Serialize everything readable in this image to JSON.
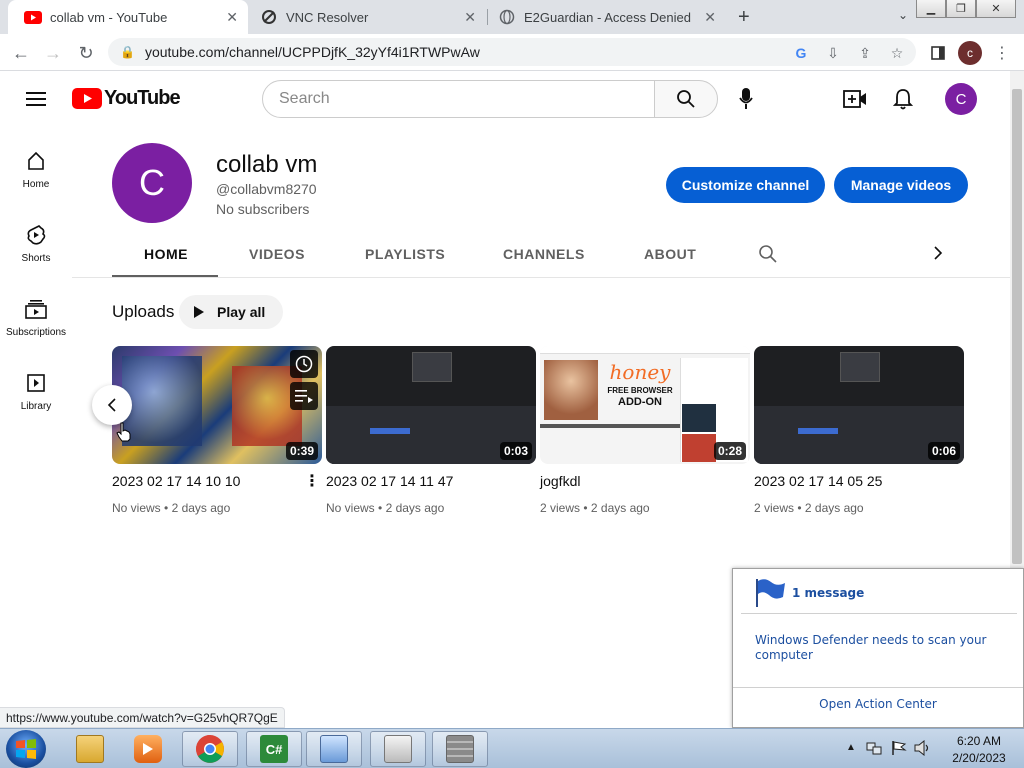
{
  "browser": {
    "tabs": [
      {
        "title": "collab vm - YouTube",
        "active": true
      },
      {
        "title": "VNC Resolver",
        "active": false
      },
      {
        "title": "E2Guardian - Access Denied",
        "active": false
      }
    ],
    "new_tab_symbol": "+",
    "url": "youtube.com/channel/UCPPDjfK_32yYf4i1RTWPwAw",
    "profile_initial": "c"
  },
  "youtube": {
    "logo_text": "YouTube",
    "search_placeholder": "Search",
    "account_initial": "C",
    "guide": [
      {
        "label": "Home",
        "icon": "home-icon"
      },
      {
        "label": "Shorts",
        "icon": "shorts-icon"
      },
      {
        "label": "Subscriptions",
        "icon": "subscriptions-icon"
      },
      {
        "label": "Library",
        "icon": "library-icon"
      }
    ],
    "channel": {
      "avatar_initial": "C",
      "name": "collab vm",
      "handle": "@collabvm8270",
      "subscribers": "No subscribers",
      "customize_label": "Customize channel",
      "manage_label": "Manage videos"
    },
    "tabs": [
      "HOME",
      "VIDEOS",
      "PLAYLISTS",
      "CHANNELS",
      "ABOUT"
    ],
    "active_tab": "HOME",
    "uploads_label": "Uploads",
    "play_all_label": "Play all",
    "videos": [
      {
        "title": "2023 02 17 14 10 10",
        "duration": "0:39",
        "views": "No views",
        "age": "2 days ago"
      },
      {
        "title": "2023 02 17 14 11 47",
        "duration": "0:03",
        "views": "No views",
        "age": "2 days ago"
      },
      {
        "title": "jogfkdl",
        "duration": "0:28",
        "views": "2 views",
        "age": "2 days ago"
      },
      {
        "title": "2023 02 17 14 05 25",
        "duration": "0:06",
        "views": "2 views",
        "age": "2 days ago"
      }
    ],
    "meta_separator": " • ",
    "thumb3": {
      "honey": "honey",
      "addon1": "FREE BROWSER",
      "addon2": "ADD-ON"
    }
  },
  "status_url": "https://www.youtube.com/watch?v=G25vhQR7QgE",
  "notification": {
    "count_text": "1 message",
    "message": "Windows Defender needs to scan your computer",
    "action": "Open Action Center"
  },
  "taskbar": {
    "time": "6:20 AM",
    "date": "2/20/2023"
  },
  "colors": {
    "youtube_red": "#ff0000",
    "brand_blue": "#065fd4",
    "avatar_purple": "#7b1fa2"
  }
}
